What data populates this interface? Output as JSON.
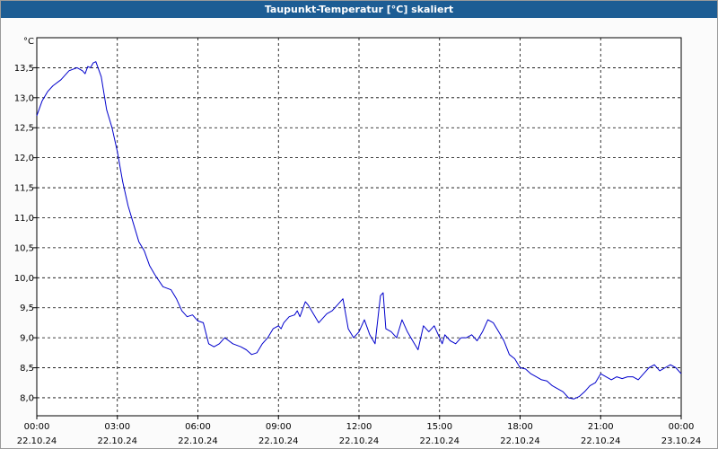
{
  "window": {
    "title": "Taupunkt-Temperatur [°C] skaliert"
  },
  "chart_data": {
    "type": "line",
    "title": "Taupunkt-Temperatur [°C] skaliert",
    "ylabel": "°C",
    "xlabel": "",
    "ylim": [
      7.7,
      14.0
    ],
    "xlim": [
      0,
      24
    ],
    "grid": true,
    "y_ticks": [
      "8,0",
      "8,5",
      "9,0",
      "9,5",
      "10,0",
      "10,5",
      "11,0",
      "11,5",
      "12,0",
      "12,5",
      "13,0",
      "13,5"
    ],
    "x_ticks": [
      {
        "time": "00:00",
        "date": "22.10.24"
      },
      {
        "time": "03:00",
        "date": "22.10.24"
      },
      {
        "time": "06:00",
        "date": "22.10.24"
      },
      {
        "time": "09:00",
        "date": "22.10.24"
      },
      {
        "time": "12:00",
        "date": "22.10.24"
      },
      {
        "time": "15:00",
        "date": "22.10.24"
      },
      {
        "time": "18:00",
        "date": "22.10.24"
      },
      {
        "time": "21:00",
        "date": "22.10.24"
      },
      {
        "time": "00:00",
        "date": "23.10.24"
      }
    ],
    "series": [
      {
        "color": "#0000cc",
        "x": [
          0.0,
          0.2,
          0.4,
          0.6,
          0.9,
          1.2,
          1.5,
          1.7,
          1.8,
          1.9,
          2.0,
          2.1,
          2.2,
          2.4,
          2.6,
          2.8,
          3.0,
          3.2,
          3.4,
          3.6,
          3.8,
          4.0,
          4.2,
          4.4,
          4.7,
          5.0,
          5.2,
          5.4,
          5.6,
          5.8,
          6.0,
          6.2,
          6.4,
          6.6,
          6.8,
          7.0,
          7.3,
          7.6,
          7.8,
          8.0,
          8.2,
          8.4,
          8.6,
          8.8,
          9.0,
          9.1,
          9.2,
          9.4,
          9.6,
          9.7,
          9.8,
          10.0,
          10.1,
          10.3,
          10.5,
          10.8,
          11.0,
          11.2,
          11.4,
          11.6,
          11.8,
          12.0,
          12.2,
          12.4,
          12.6,
          12.8,
          12.9,
          13.0,
          13.2,
          13.4,
          13.6,
          13.8,
          14.0,
          14.2,
          14.4,
          14.6,
          14.8,
          15.0,
          15.1,
          15.2,
          15.4,
          15.6,
          15.8,
          16.0,
          16.2,
          16.4,
          16.6,
          16.8,
          17.0,
          17.2,
          17.4,
          17.6,
          17.8,
          18.0,
          18.2,
          18.4,
          18.6,
          18.8,
          19.0,
          19.2,
          19.4,
          19.6,
          19.8,
          20.0,
          20.2,
          20.4,
          20.6,
          20.8,
          21.0,
          21.2,
          21.4,
          21.6,
          21.8,
          22.0,
          22.2,
          22.4,
          22.6,
          22.8,
          23.0,
          23.2,
          23.4,
          23.6,
          23.8,
          24.0
        ],
        "y": [
          12.7,
          12.95,
          13.1,
          13.2,
          13.3,
          13.45,
          13.5,
          13.45,
          13.4,
          13.52,
          13.5,
          13.58,
          13.6,
          13.35,
          12.8,
          12.5,
          12.1,
          11.6,
          11.2,
          10.9,
          10.6,
          10.45,
          10.2,
          10.05,
          9.85,
          9.8,
          9.65,
          9.45,
          9.35,
          9.38,
          9.28,
          9.25,
          8.9,
          8.85,
          8.9,
          9.0,
          8.9,
          8.85,
          8.8,
          8.72,
          8.75,
          8.9,
          9.0,
          9.15,
          9.2,
          9.15,
          9.25,
          9.35,
          9.38,
          9.45,
          9.35,
          9.6,
          9.55,
          9.4,
          9.25,
          9.4,
          9.45,
          9.55,
          9.65,
          9.15,
          9.0,
          9.1,
          9.3,
          9.05,
          8.9,
          9.7,
          9.75,
          9.15,
          9.1,
          9.0,
          9.3,
          9.1,
          8.95,
          8.8,
          9.2,
          9.1,
          9.2,
          9.0,
          8.9,
          9.05,
          8.95,
          8.9,
          9.0,
          9.0,
          9.05,
          8.95,
          9.1,
          9.3,
          9.25,
          9.1,
          8.95,
          8.72,
          8.65,
          8.5,
          8.48,
          8.4,
          8.35,
          8.3,
          8.28,
          8.2,
          8.15,
          8.1,
          8.0,
          7.98,
          8.02,
          8.1,
          8.2,
          8.25,
          8.4,
          8.35,
          8.3,
          8.35,
          8.32,
          8.35,
          8.35,
          8.3,
          8.4,
          8.5,
          8.55,
          8.45,
          8.5,
          8.55,
          8.5,
          8.4
        ]
      }
    ]
  }
}
